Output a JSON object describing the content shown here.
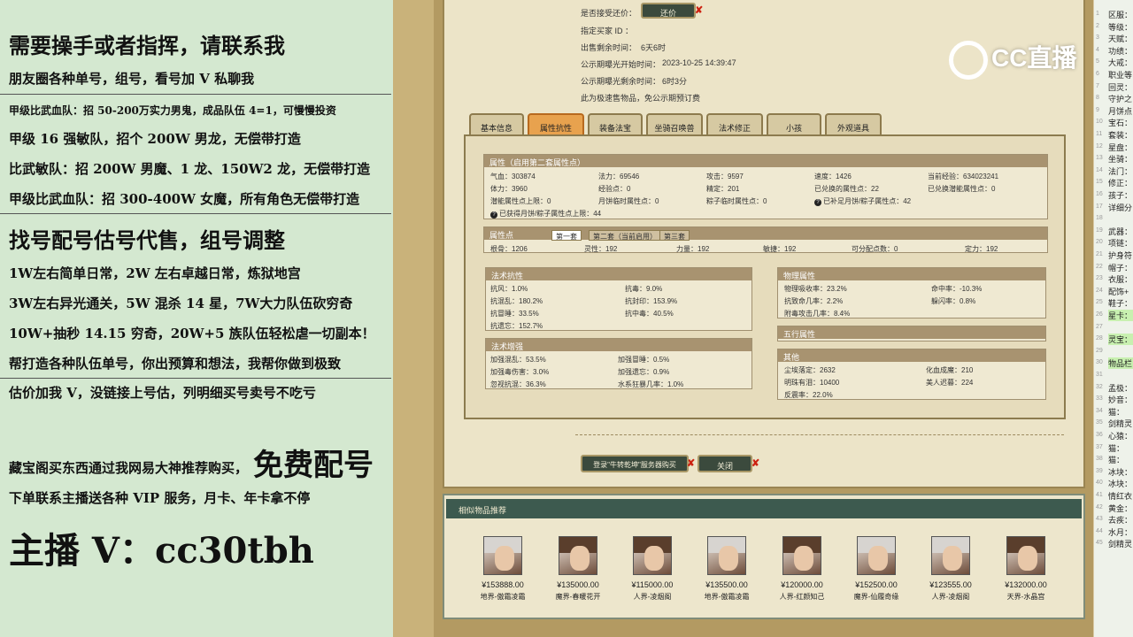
{
  "left_panel": {
    "lines": [
      "需要操手或者指挥，请联系我",
      "朋友圈各种单号，组号，看号加 V 私聊我",
      "甲级比武血队：招 50-200万实力男鬼，成品队伍 4=1，可慢慢投资",
      "甲级 16 强敏队，招个 200W 男龙，无偿带打造",
      "比武敏队：招 200W 男魔、1 龙、150W2 龙，无偿带打造",
      "甲级比武血队：招 300-400W 女魔，所有角色无偿带打造",
      "找号配号估号代售，组号调整",
      "1W左右简单日常，2W 左右卓越日常，炼狱地宫",
      "3W左右异光通关，5W 混杀 14 星，7W大力队伍砍穷奇",
      "10W+抽秒 14.15 穷奇，20W+5 族队伍轻松虐一切副本！",
      "帮打造各种队伍单号，你出预算和想法，我帮你做到极致",
      "估价加我 V，没链接上号估，列明细买号卖号不吃亏",
      "藏宝阁买东西通过我网易大神推荐购买，",
      "免费配号",
      "下单联系主播送各种 VIP 服务，月卡、年卡拿不停",
      "主播 V：cc30tbh"
    ]
  },
  "trade": {
    "accept_label": "是否接受还价：",
    "counter_button": "还价",
    "buyer_label": "指定买家 ID ：",
    "remain_label": "出售剩余时间：",
    "remain_value": "6天6时",
    "start_label": "公示期曝光开始时间：",
    "start_value": "2023-10-25 14:39:47",
    "expose_label": "公示期曝光剩余时间：",
    "expose_value": "6时3分",
    "notice": "此为极速售物品，免公示期预订费"
  },
  "tabs": [
    "基本信息",
    "属性抗性",
    "装备法宝",
    "坐骑召唤兽",
    "法术修正",
    "小孩",
    "外观道具"
  ],
  "attr": {
    "title": "属性（启用第二套属性点）",
    "rows": [
      [
        "气血：303874",
        "法力：69546",
        "攻击：9597",
        "速度：1426",
        "当前经验：634023241"
      ],
      [
        "体力：3960",
        "经验点：0",
        "精定：201",
        "已兑换的属性点：22",
        "已兑换潜能属性点：0"
      ],
      [
        "潜能属性点上限：0",
        "月饼临时属性点：0",
        "粽子临时属性点：0",
        "已补足月饼/粽子属性点：42",
        ""
      ]
    ],
    "footer": "已获得月饼/粽子属性点上限：44"
  },
  "points": {
    "title": "属性点",
    "subtabs": [
      "第一套",
      "第二套（当前启用）",
      "第三套"
    ],
    "values": [
      "根骨：1206",
      "灵性：192",
      "力量：192",
      "敏捷：192",
      "可分配点数：0",
      "定力：192"
    ]
  },
  "resist": {
    "title": "法术抗性",
    "rows": [
      [
        "抗风：1.0%",
        "抗毒：9.0%"
      ],
      [
        "抗混乱：180.2%",
        "抗封印：153.9%"
      ],
      [
        "抗冒睡：33.5%",
        "抗中毒：40.5%"
      ],
      [
        "抗遗忘：152.7%",
        ""
      ]
    ]
  },
  "boost": {
    "title": "法术增强",
    "rows": [
      [
        "加强混乱：53.5%",
        "加强冒睡：0.5%"
      ],
      [
        "加强毒伤害：3.0%",
        "加强遗忘：0.9%"
      ],
      [
        "忽视抗混：36.3%",
        "水系狂暴几率：1.0%"
      ]
    ]
  },
  "physical": {
    "title": "物理属性",
    "rows": [
      [
        "物理吸收率：23.2%",
        "命中率：-10.3%"
      ],
      [
        "抗致命几率：2.2%",
        "躲闪率：0.8%"
      ],
      [
        "附毒攻击几率：8.4%",
        ""
      ]
    ]
  },
  "five": {
    "title": "五行属性"
  },
  "other": {
    "title": "其他",
    "rows": [
      [
        "尘埃落定：2632",
        "化血成魔：210"
      ],
      [
        "明珠有泪：10400",
        "美人迟暮：224"
      ],
      [
        "反震率：22.0%",
        ""
      ]
    ]
  },
  "actions": {
    "login": "登录\"牛转乾坤\"服务器购买",
    "close": "关闭"
  },
  "recommend": {
    "title": "相似物品推荐",
    "items": [
      {
        "price": "¥153888.00",
        "server": "地界-傲霜凌霜"
      },
      {
        "price": "¥135000.00",
        "server": "魔界-春暖花开"
      },
      {
        "price": "¥115000.00",
        "server": "人界-凌烟阁"
      },
      {
        "price": "¥135500.00",
        "server": "地界-傲霜凌霜"
      },
      {
        "price": "¥120000.00",
        "server": "人界-红颜知己"
      },
      {
        "price": "¥152500.00",
        "server": "魔界-仙履奇缘"
      },
      {
        "price": "¥123555.00",
        "server": "人界-凌烟阁"
      },
      {
        "price": "¥132000.00",
        "server": "天界-水晶宫"
      }
    ]
  },
  "right_list": [
    "区服：",
    "等级：",
    "天赋：",
    "功绩：",
    "大戒：",
    "职业等",
    "回灵：",
    "守护之",
    "月饼点",
    "宝石：",
    "套装：",
    "星盘：",
    "坐骑：",
    "法门：",
    "修正：",
    "孩子：",
    "详细分",
    "",
    "武器：",
    "项链：",
    "护身符",
    "帽子：",
    "衣服：",
    "配饰+",
    "鞋子：",
    "星卡：",
    "",
    "灵宝：",
    "",
    "物品栏",
    "",
    "孟极：",
    "妙音：",
    "猫：",
    "剑精灵",
    "心猿：",
    "猫：",
    "猫：",
    "冰块：",
    "冰块：",
    "情红衣",
    "黄金：",
    "去疾：",
    "水月：",
    "剑精灵"
  ],
  "logo": "CC直播"
}
